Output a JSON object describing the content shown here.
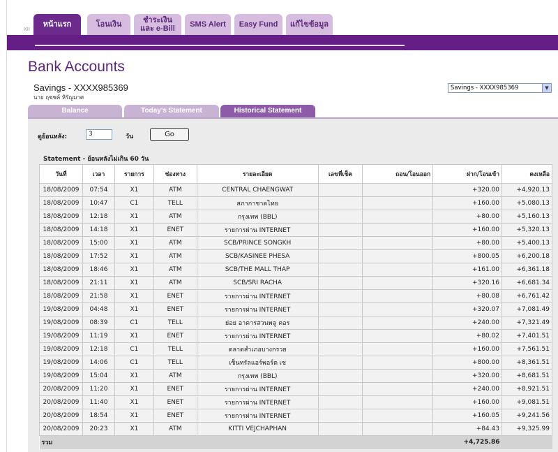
{
  "nav": {
    "corner_mark": "XII",
    "tabs": [
      {
        "label": "หน้าแรก",
        "active": true
      },
      {
        "label": "โอนเงิน",
        "active": false
      },
      {
        "label": "ชำระเงิน\nและ e-Bill",
        "active": false
      },
      {
        "label": "SMS Alert",
        "active": false
      },
      {
        "label": "Easy Fund",
        "active": false
      },
      {
        "label": "แก้ไขข้อมูล",
        "active": false
      }
    ]
  },
  "page": {
    "title": "Bank Accounts"
  },
  "account": {
    "name": "Savings - XXXX985369",
    "holder": "นาย ฤชชค์ หิรัญมาศ",
    "selector_value": "Savings - XXXX985369"
  },
  "subtabs": [
    {
      "label": "Balance",
      "active": false
    },
    {
      "label": "Today's Statement",
      "active": false
    },
    {
      "label": "Historical Statement",
      "active": true
    }
  ],
  "filter": {
    "label": "ดูย้อนหลัง:",
    "days_value": "3",
    "unit": "วัน",
    "go_label": "Go"
  },
  "statement": {
    "caption": "Statement - ย้อนหลังไม่เกิน 60 วัน",
    "columns": [
      "วันที่",
      "เวลา",
      "รายการ",
      "ช่องทาง",
      "รายละเอียด",
      "เลขที่เช็ค",
      "ถอน/โอนออก",
      "ฝาก/โอนเข้า",
      "คงเหลือ"
    ],
    "rows": [
      [
        "18/08/2009",
        "07:54",
        "X1",
        "ATM",
        "CENTRAL CHAENGWAT",
        "",
        "",
        "+320.00",
        "+4,920.13"
      ],
      [
        "18/08/2009",
        "10:47",
        "C1",
        "TELL",
        "สภากาชาดไทย",
        "",
        "",
        "+160.00",
        "+5,080.13"
      ],
      [
        "18/08/2009",
        "12:18",
        "X1",
        "ATM",
        "กรุงเทพ (BBL)",
        "",
        "",
        "+80.00",
        "+5,160.13"
      ],
      [
        "18/08/2009",
        "14:18",
        "X1",
        "ENET",
        "รายการผ่าน INTERNET",
        "",
        "",
        "+160.00",
        "+5,320.13"
      ],
      [
        "18/08/2009",
        "15:00",
        "X1",
        "ATM",
        "SCB/PRINCE SONGKH",
        "",
        "",
        "+80.00",
        "+5,400.13"
      ],
      [
        "18/08/2009",
        "17:52",
        "X1",
        "ATM",
        "SCB/KASINEE PHESA",
        "",
        "",
        "+800.05",
        "+6,200.18"
      ],
      [
        "18/08/2009",
        "18:46",
        "X1",
        "ATM",
        "SCB/THE MALL THAP",
        "",
        "",
        "+161.00",
        "+6,361.18"
      ],
      [
        "18/08/2009",
        "21:11",
        "X1",
        "ATM",
        "SCB/SRI RACHA",
        "",
        "",
        "+320.16",
        "+6,681.34"
      ],
      [
        "18/08/2009",
        "21:58",
        "X1",
        "ENET",
        "รายการผ่าน INTERNET",
        "",
        "",
        "+80.08",
        "+6,761.42"
      ],
      [
        "19/08/2009",
        "04:48",
        "X1",
        "ENET",
        "รายการผ่าน INTERNET",
        "",
        "",
        "+320.07",
        "+7,081.49"
      ],
      [
        "19/08/2009",
        "08:39",
        "C1",
        "TELL",
        "ย่อย อาคารสวนพลู คอร",
        "",
        "",
        "+240.00",
        "+7,321.49"
      ],
      [
        "19/08/2009",
        "11:19",
        "X1",
        "ENET",
        "รายการผ่าน INTERNET",
        "",
        "",
        "+80.02",
        "+7,401.51"
      ],
      [
        "19/08/2009",
        "12:18",
        "C1",
        "TELL",
        "ตลาดสำเภอบางกรวย",
        "",
        "",
        "+160.00",
        "+7,561.51"
      ],
      [
        "19/08/2009",
        "14:06",
        "C1",
        "TELL",
        "เซ็นทรัลแอร์พอร์ต เช",
        "",
        "",
        "+800.00",
        "+8,361.51"
      ],
      [
        "19/08/2009",
        "15:04",
        "X1",
        "ATM",
        "กรุงเทพ (BBL)",
        "",
        "",
        "+320.00",
        "+8,681.51"
      ],
      [
        "20/08/2009",
        "11:20",
        "X1",
        "ENET",
        "รายการผ่าน INTERNET",
        "",
        "",
        "+240.00",
        "+8,921.51"
      ],
      [
        "20/08/2009",
        "11:40",
        "X1",
        "ENET",
        "รายการผ่าน INTERNET",
        "",
        "",
        "+160.00",
        "+9,081.51"
      ],
      [
        "20/08/2009",
        "18:54",
        "X1",
        "ENET",
        "รายการผ่าน INTERNET",
        "",
        "",
        "+160.05",
        "+9,241.56"
      ],
      [
        "20/08/2009",
        "20:23",
        "X1",
        "ATM",
        "KITTI VEJCHAPHAN",
        "",
        "",
        "+84.43",
        "+9,325.99"
      ]
    ],
    "total_label": "รวม",
    "total_deposit": "+4,725.86"
  }
}
